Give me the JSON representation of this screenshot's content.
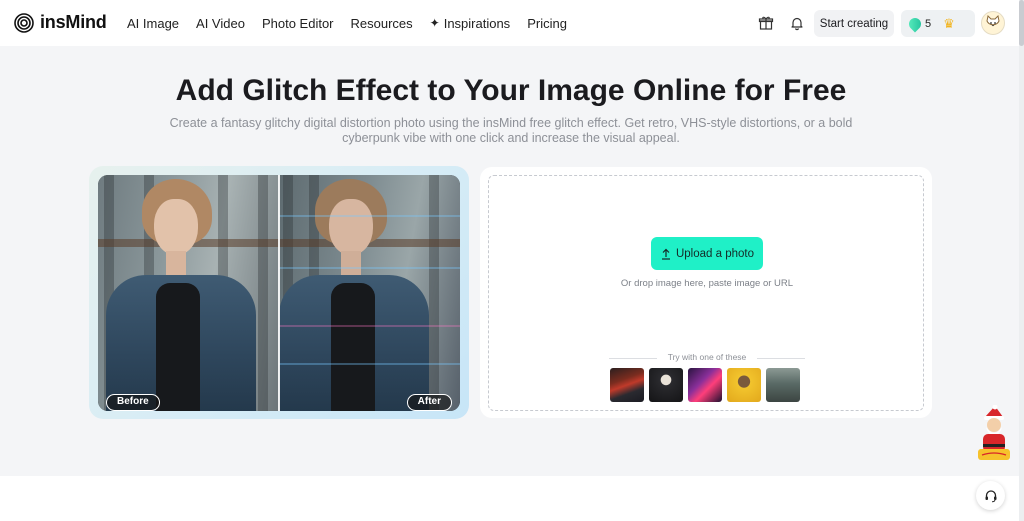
{
  "header": {
    "logo_text": "insMind",
    "nav": [
      {
        "label": "AI Image"
      },
      {
        "label": "AI Video"
      },
      {
        "label": "Photo Editor"
      },
      {
        "label": "Resources"
      },
      {
        "label": "Inspirations",
        "icon": "sparkle-icon"
      },
      {
        "label": "Pricing"
      }
    ],
    "start_creating": "Start creating",
    "credits": "5",
    "icons": [
      "gift-icon",
      "bell-icon",
      "gem-icon",
      "crown-icon",
      "avatar"
    ]
  },
  "hero": {
    "title": "Add Glitch Effect to Your Image Online for Free",
    "subtitle": "Create a fantasy glitchy digital distortion photo using the insMind free glitch effect. Get retro, VHS-style distortions, or a bold cyberpunk vibe with one click and increase the visual appeal."
  },
  "compare": {
    "before_label": "Before",
    "after_label": "After"
  },
  "upload": {
    "button_label": "Upload a photo",
    "hint": "Or drop image here, paste image or URL",
    "try_label": "Try with one of these",
    "samples": [
      {
        "name": "sample-neon-room",
        "color": "#3a2b2b"
      },
      {
        "name": "sample-dark-portrait",
        "color": "#1f1f22"
      },
      {
        "name": "sample-purple-neon",
        "color": "#7a2f86"
      },
      {
        "name": "sample-yellow-man",
        "color": "#e2b12c"
      },
      {
        "name": "sample-street-man",
        "color": "#5c6a66"
      }
    ]
  },
  "colors": {
    "accent": "#1ff0c7",
    "title": "#1b1b1f",
    "subtitle": "#8d9097"
  }
}
